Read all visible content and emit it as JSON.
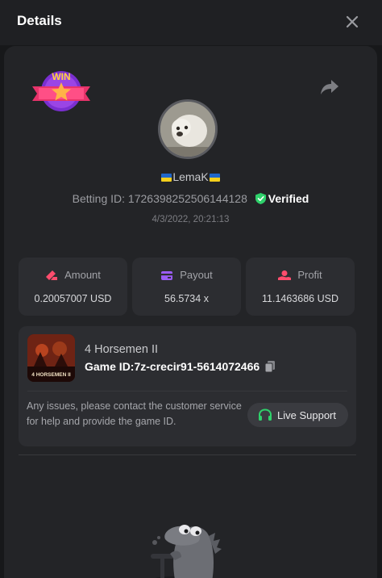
{
  "header": {
    "title": "Details"
  },
  "user": {
    "name": "LemaK",
    "verified_label": "Verified"
  },
  "bet": {
    "label": "Betting ID:",
    "id": "1726398252506144128",
    "timestamp": "4/3/2022, 20:21:13"
  },
  "badge": {
    "text": "WIN"
  },
  "stats": [
    {
      "label": "Amount",
      "value": "0.20057007 USD",
      "color": "#ff4d6d"
    },
    {
      "label": "Payout",
      "value": "56.5734 x",
      "color": "#9b5cf6"
    },
    {
      "label": "Profit",
      "value": "11.1463686 USD",
      "color": "#ff4d6d"
    }
  ],
  "game": {
    "name": "4 Horsemen II",
    "id_label": "Game ID:",
    "id_value": "7z-crecir91-5614072466",
    "thumb_text": "4 HORSEMEN II"
  },
  "support": {
    "help_text": "Any issues, please contact the customer service for help and provide the game ID.",
    "button_label": "Live Support",
    "accent": "#2fd16b"
  },
  "colors": {
    "verified": "#2fd16b",
    "panel": "#232427",
    "card": "#2c2d31"
  }
}
